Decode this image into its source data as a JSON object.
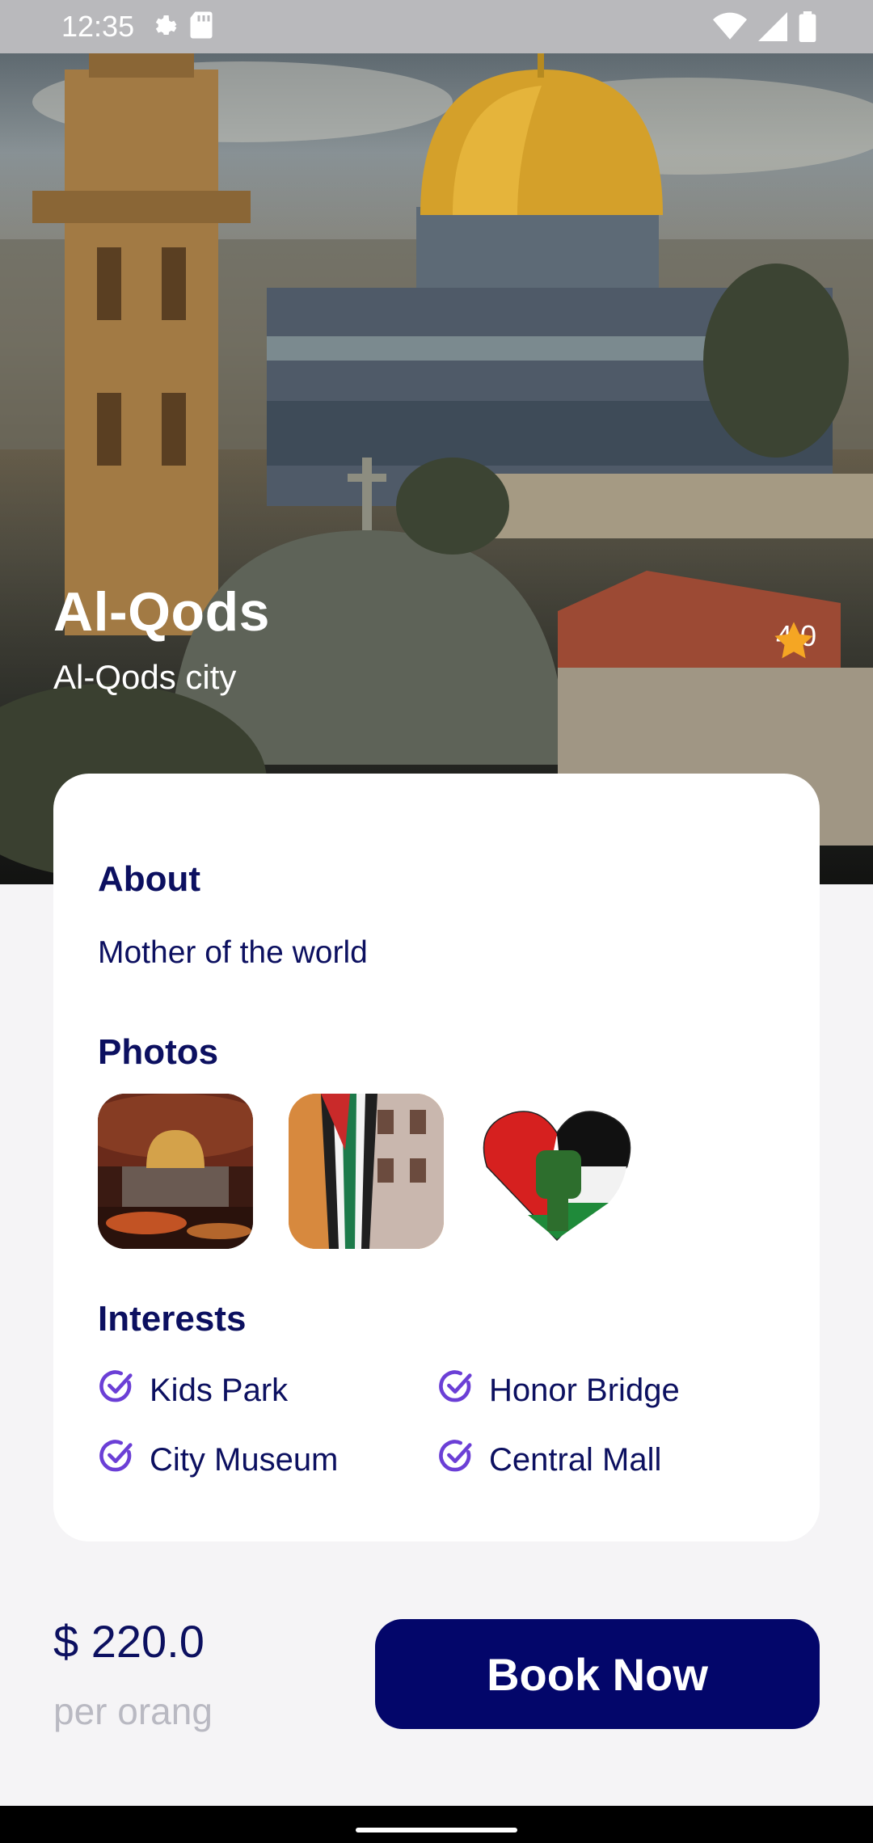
{
  "status_bar": {
    "time": "12:35",
    "left_icons": [
      "gear-icon",
      "sd-card-icon"
    ],
    "right_icons": [
      "wifi-icon",
      "signal-icon",
      "battery-icon"
    ]
  },
  "hero": {
    "title": "Al-Qods",
    "subtitle": "Al-Qods city",
    "rating": "4.0",
    "rating_icon": "star-icon",
    "rating_color": "#f5a623"
  },
  "about": {
    "title": "About",
    "text": "Mother of the world"
  },
  "photos": {
    "title": "Photos",
    "items": [
      "dome-of-the-rock-photo",
      "palestine-flag-photo",
      "heart-fist-photo"
    ]
  },
  "interests": {
    "title": "Interests",
    "items": [
      "Kids Park",
      "Honor Bridge",
      "City Museum",
      "Central Mall"
    ],
    "check_color": "#6b3fd6"
  },
  "footer": {
    "price": "$ 220.0",
    "per_unit": "per orang",
    "book_label": "Book Now",
    "button_color": "#03066a"
  }
}
